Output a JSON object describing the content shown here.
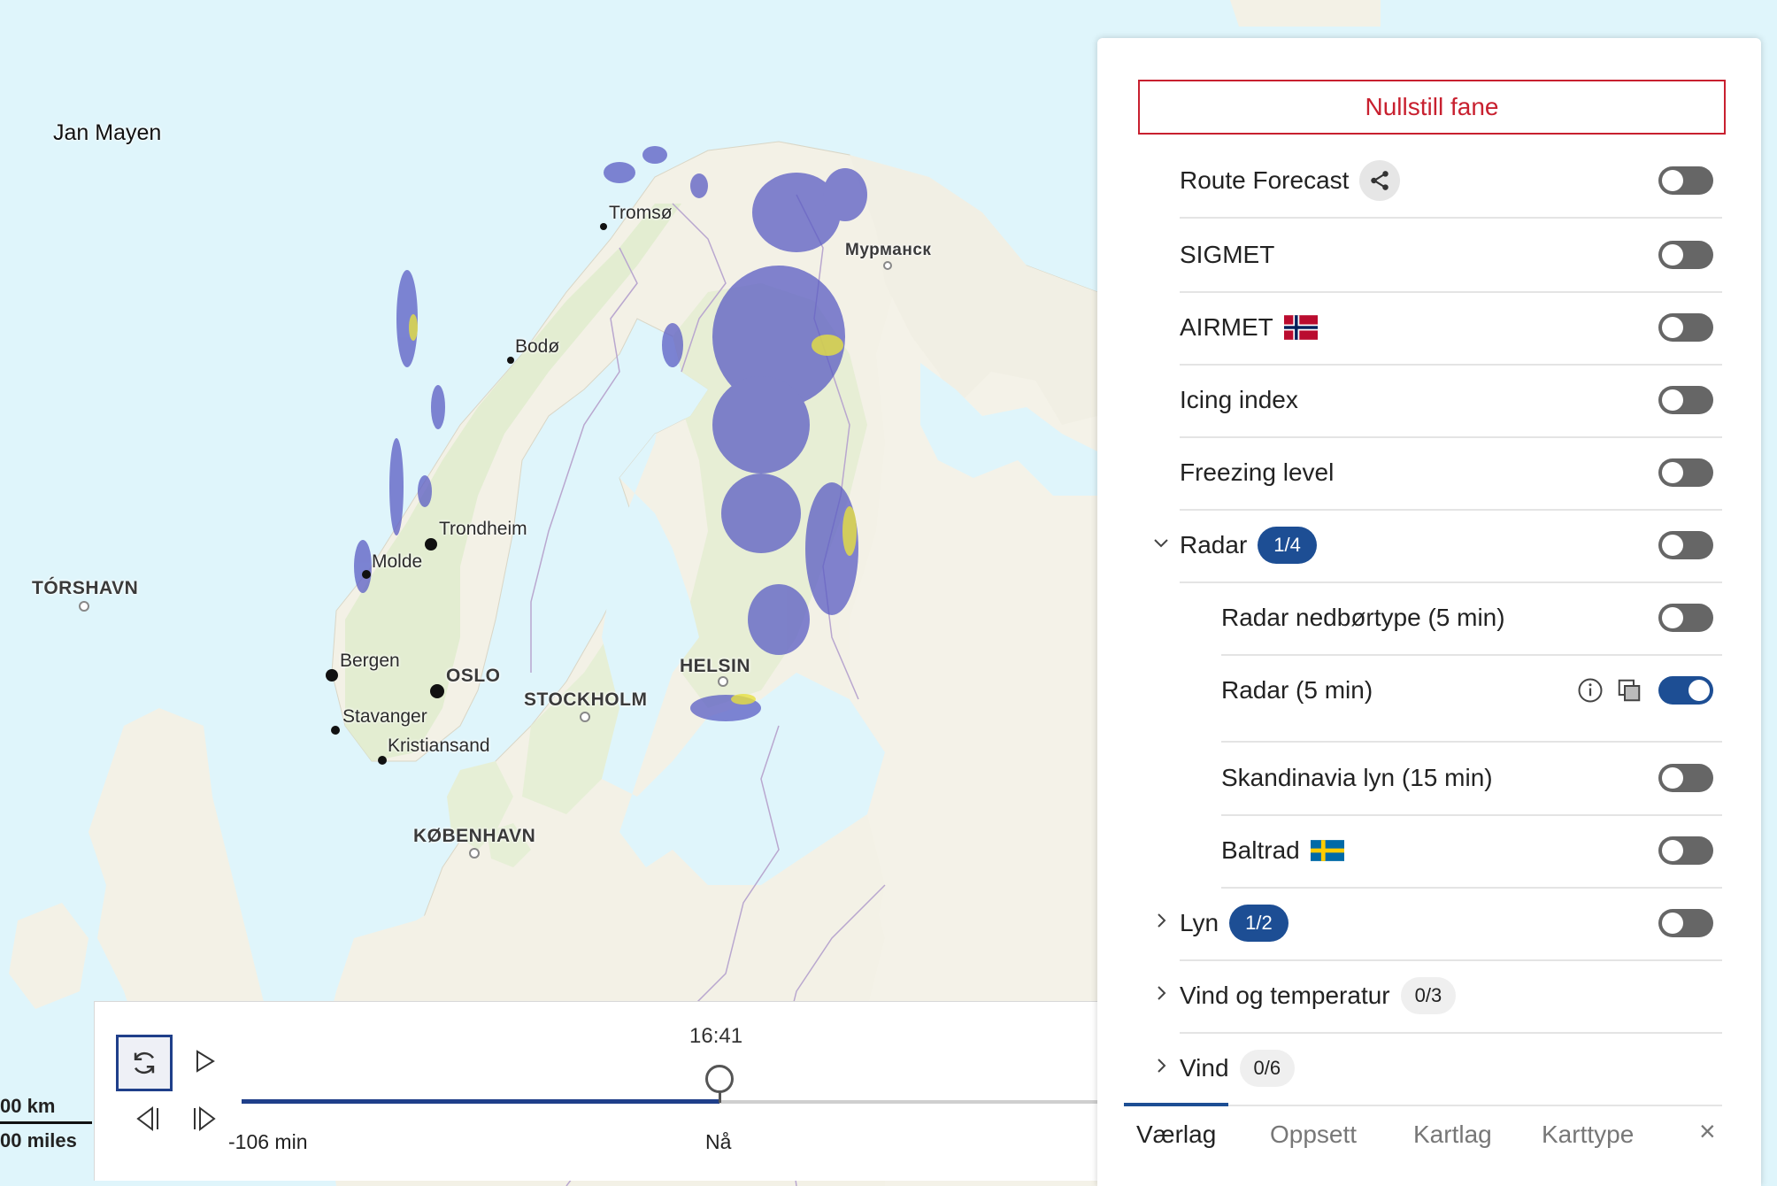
{
  "map": {
    "labels": {
      "jan_mayen": "Jan Mayen",
      "torshavn": "TÓRSHAVN",
      "tromso": "Tromsø",
      "murmansk": "Мурманск",
      "bodo": "Bodø",
      "trondheim": "Trondheim",
      "molde": "Molde",
      "bergen": "Bergen",
      "oslo": "OSLO",
      "stockholm": "STOCKHOLM",
      "helsinki": "HELSIN",
      "stavanger": "Stavanger",
      "kristiansand": "Kristiansand",
      "kobenhavn": "KØBENHAVN"
    },
    "scale": {
      "km": "00 km",
      "miles": "00 miles"
    }
  },
  "timeline": {
    "time": "16:41",
    "start_label": "-106 min",
    "now_label": "Nå",
    "progress_fraction": 1.0
  },
  "panel": {
    "reset_label": "Nullstill fane",
    "rows": {
      "route_forecast": {
        "label": "Route Forecast",
        "on": false
      },
      "sigmet": {
        "label": "SIGMET",
        "on": false
      },
      "airmet": {
        "label": "AIRMET",
        "flag": "Norway",
        "on": false
      },
      "icing": {
        "label": "Icing index",
        "on": false
      },
      "freezing": {
        "label": "Freezing level",
        "on": false
      },
      "radar": {
        "label": "Radar",
        "count": "1/4",
        "on": false
      },
      "radar_type": {
        "label": "Radar nedbørtype (5 min)",
        "on": false
      },
      "radar_5": {
        "label": "Radar (5 min)",
        "on": true
      },
      "skandinavia_lyn": {
        "label": "Skandinavia lyn (15 min)",
        "on": false
      },
      "baltrad": {
        "label": "Baltrad",
        "flag": "Sweden",
        "on": false
      },
      "lyn": {
        "label": "Lyn",
        "count": "1/2",
        "on": false
      },
      "vind_temp": {
        "label": "Vind og temperatur",
        "count": "0/3"
      },
      "vind": {
        "label": "Vind",
        "count": "0/6"
      }
    },
    "tabs": {
      "vaerlag": "Værlag",
      "oppsett": "Oppsett",
      "kartlag": "Kartlag",
      "karttype": "Karttype",
      "close": "×"
    }
  },
  "colors": {
    "accent": "#1d4e94",
    "reset_red": "#c8202f",
    "sea": "#dff5fb",
    "land": "#f3f1e6",
    "radar": "#5a5cc4",
    "radar_heavy": "#e6e040"
  }
}
